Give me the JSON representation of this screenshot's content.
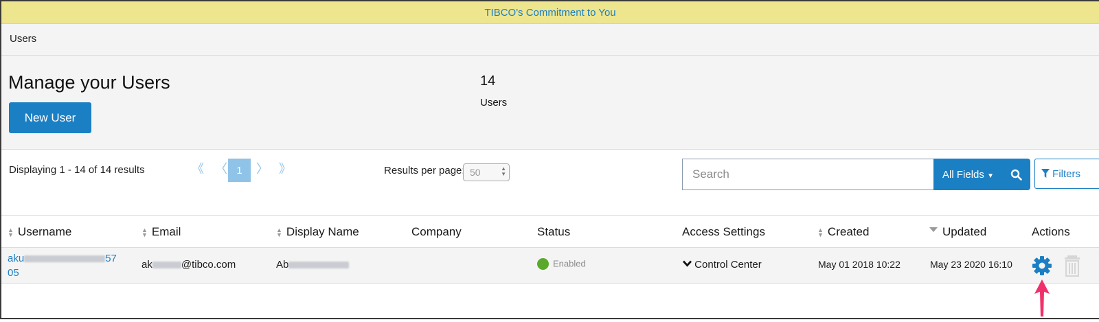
{
  "banner": {
    "text": "TIBCO's Commitment to You"
  },
  "breadcrumb": {
    "current": "Users"
  },
  "header": {
    "title": "Manage your Users",
    "new_user_label": "New User",
    "count": "14",
    "count_label": "Users"
  },
  "pagination": {
    "summary": "Displaying 1 - 14 of 14 results",
    "first": "《",
    "prev": "〈",
    "current_page": "1",
    "next": "〉",
    "last": "》",
    "per_page_label": "Results per page:",
    "per_page_value": "50"
  },
  "search": {
    "placeholder": "Search",
    "field_label": "All Fields",
    "filters_label": "Filters"
  },
  "table": {
    "columns": {
      "username": "Username",
      "email": "Email",
      "display_name": "Display Name",
      "company": "Company",
      "status": "Status",
      "access_settings": "Access Settings",
      "created": "Created",
      "updated": "Updated",
      "actions": "Actions"
    },
    "rows": [
      {
        "username_prefix": "aku",
        "username_suffix": "57",
        "username_line2": "05",
        "email_prefix": "ak",
        "email_suffix": "@tibco.com",
        "display_name_prefix": "Ab",
        "company": "",
        "status": "Enabled",
        "access_settings": "Control Center",
        "created": "May 01 2018 10:22",
        "updated": "May 23 2020 16:10"
      }
    ]
  },
  "colors": {
    "accent": "#1b7fc4",
    "banner_bg": "#eee58f",
    "status_enabled": "#5aa92c",
    "annotation_arrow": "#f0306a"
  },
  "icons": {
    "row_actions": [
      "gear-icon",
      "trash-icon"
    ],
    "search": "search-icon",
    "filters": "filter-icon",
    "sort": "sort-icon"
  }
}
